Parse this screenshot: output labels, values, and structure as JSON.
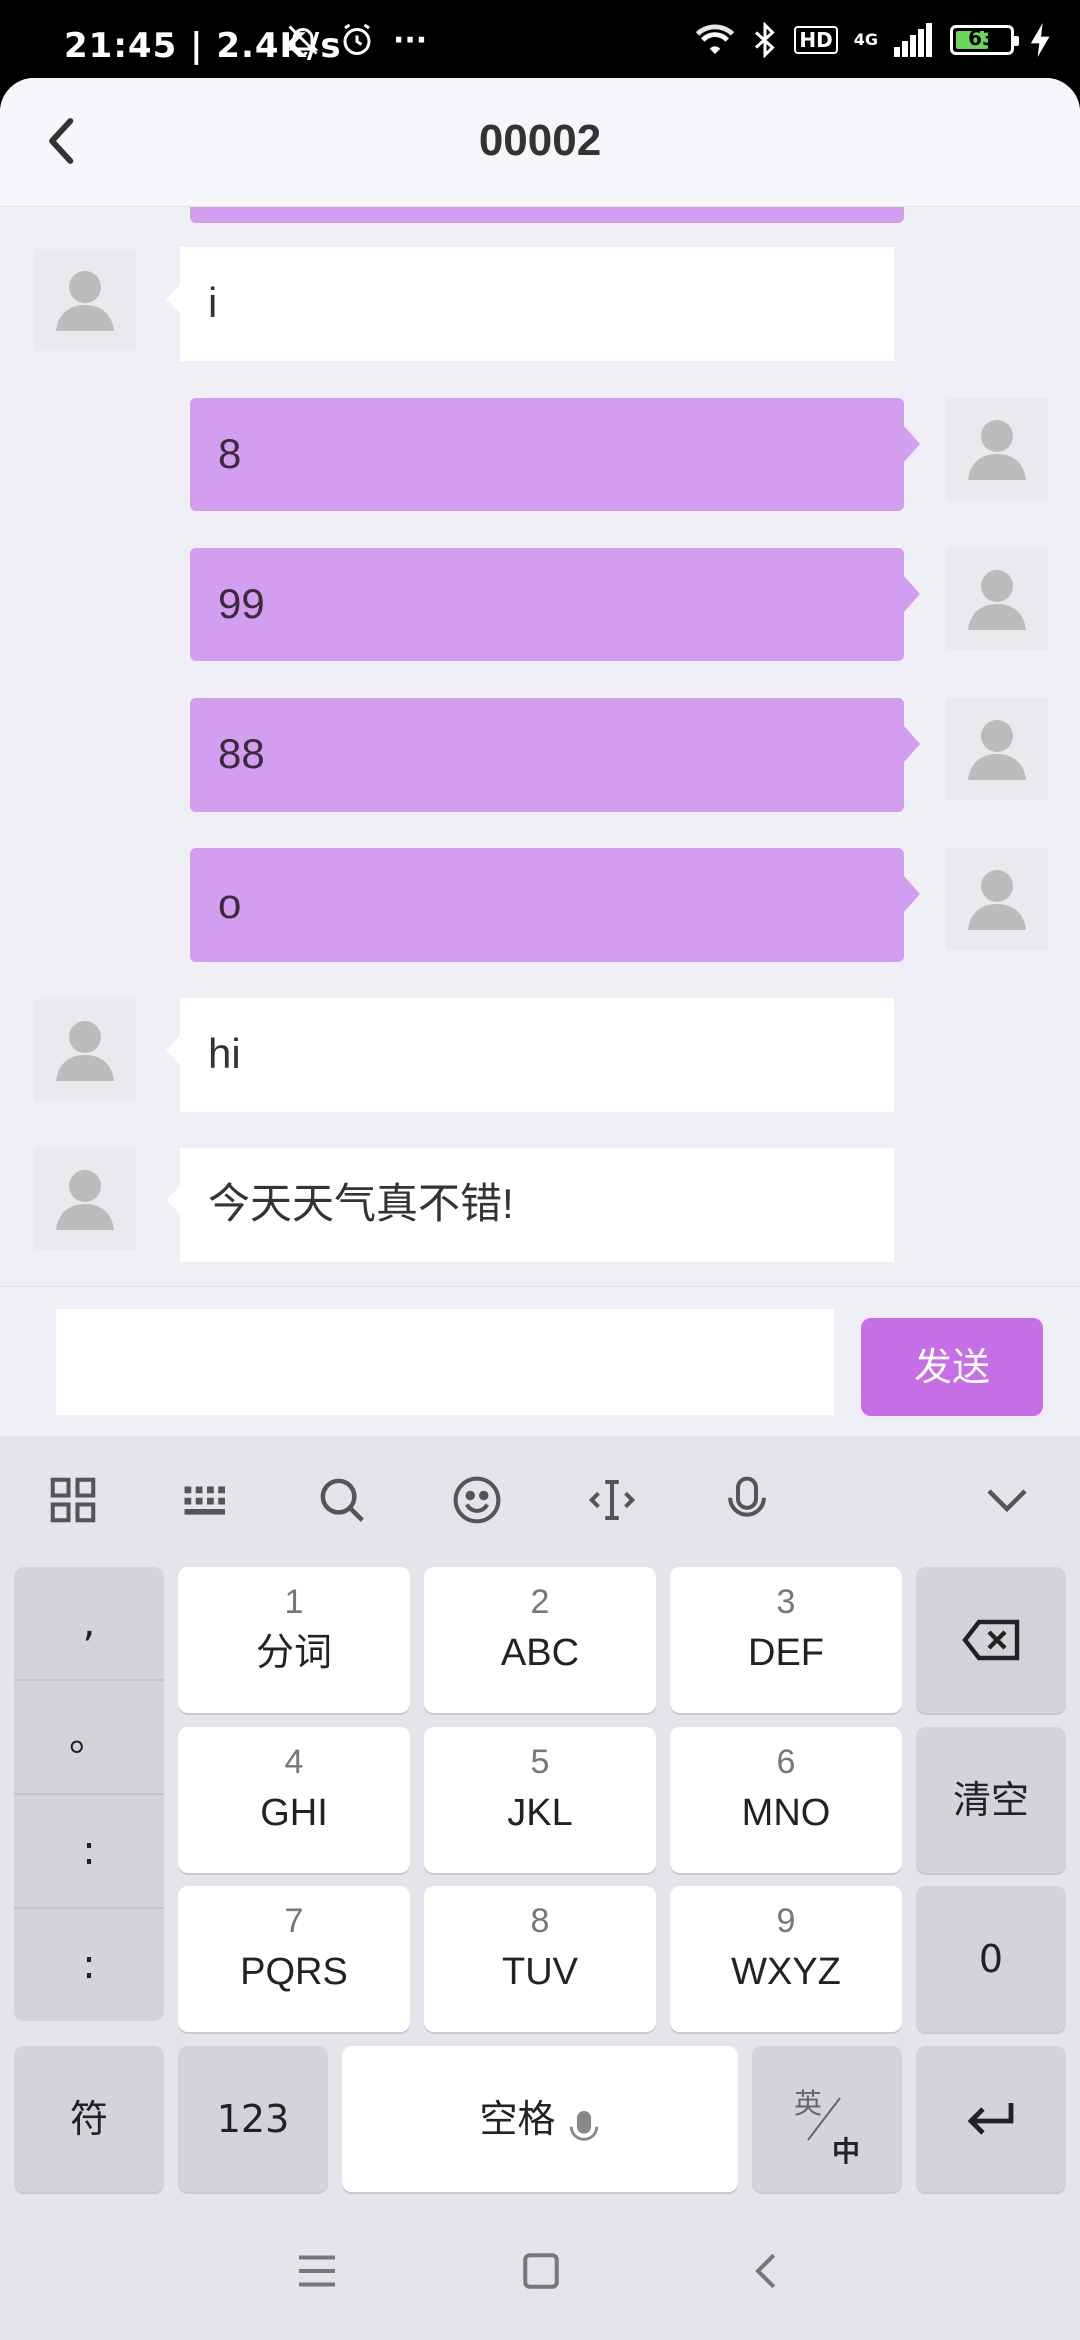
{
  "status_bar": {
    "time": "21:45 | 2.4K/s",
    "more": "···",
    "hd": "HD",
    "network": "4G",
    "battery": "63",
    "battery_fraction": 0.63
  },
  "header": {
    "title": "00002"
  },
  "messages": [
    {
      "side": "right",
      "text": ""
    },
    {
      "side": "left",
      "text": "i"
    },
    {
      "side": "right",
      "text": "8"
    },
    {
      "side": "right",
      "text": "99"
    },
    {
      "side": "right",
      "text": "88"
    },
    {
      "side": "right",
      "text": "o"
    },
    {
      "side": "left",
      "text": "hi"
    },
    {
      "side": "left",
      "text": "今天天气真不错!"
    }
  ],
  "composer": {
    "value": "",
    "send_label": "发送"
  },
  "keyboard": {
    "punct": [
      ",",
      "。",
      ":",
      ":"
    ],
    "keys": [
      {
        "num": "1",
        "label": "分词"
      },
      {
        "num": "2",
        "label": "ABC"
      },
      {
        "num": "3",
        "label": "DEF"
      },
      {
        "num": "4",
        "label": "GHI"
      },
      {
        "num": "5",
        "label": "JKL"
      },
      {
        "num": "6",
        "label": "MNO"
      },
      {
        "num": "7",
        "label": "PQRS"
      },
      {
        "num": "8",
        "label": "TUV"
      },
      {
        "num": "9",
        "label": "WXYZ"
      }
    ],
    "clear_label": "清空",
    "zero_label": "0",
    "symbol_label": "符",
    "numeric_label": "123",
    "space_label": "空格",
    "lang_en": "英",
    "lang_zh": "中"
  },
  "colors": {
    "accent": "#c56ee6",
    "bubble_right": "#d39ef0"
  }
}
